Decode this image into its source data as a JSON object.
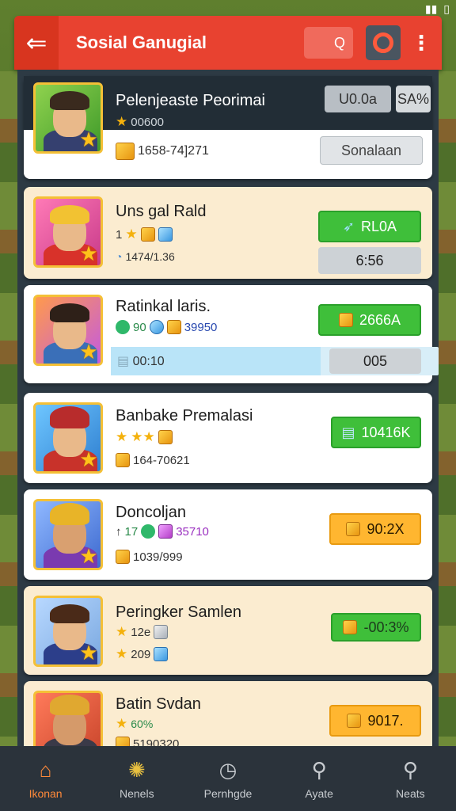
{
  "header": {
    "title": "Sosial Ganugial",
    "back_icon": "arrow-left-icon",
    "search_glyph": "Q",
    "more_glyph": "⋮",
    "accent": "#e84230"
  },
  "players": [
    {
      "name": "Pelenjeaste Peorimai",
      "stars_text": "00600",
      "resource": "1658-74]271",
      "chip1": "U0.0a",
      "chip2": "SA%",
      "action": "Sonalaan"
    },
    {
      "name": "Uns gal Rald",
      "stars_prefix": "1",
      "resource": "1474/1.36",
      "action": "RL0A",
      "secondary": "6:56"
    },
    {
      "name": "Ratinkal laris.",
      "gems_a": "90",
      "gems_b": "39950",
      "action": "2666A",
      "progress_text": "00:10",
      "progress_fraction": 0.64,
      "secondary": "005"
    },
    {
      "name": "Banbake Premalasi",
      "resource": "164-70621",
      "action": "10416K"
    },
    {
      "name": "Doncoljan",
      "level_text": "17",
      "gems": "35710",
      "resource": "1039/999",
      "action": "90:2X"
    },
    {
      "name": "Peringker Samlen",
      "stars_text": "12e",
      "resource": "209",
      "action": "-00:3%"
    },
    {
      "name": "Batin Svdan",
      "stars_text": "60%",
      "resource": "5190320",
      "action": "9017."
    }
  ],
  "nav": [
    {
      "label": "Ikonan",
      "icon": "home-icon",
      "active": true
    },
    {
      "label": "Nenels",
      "icon": "sun-icon",
      "active": false
    },
    {
      "label": "Pernhgde",
      "icon": "compass-icon",
      "active": false
    },
    {
      "label": "Ayate",
      "icon": "search-icon",
      "active": false
    },
    {
      "label": "Neats",
      "icon": "magnifier-icon",
      "active": false
    }
  ]
}
